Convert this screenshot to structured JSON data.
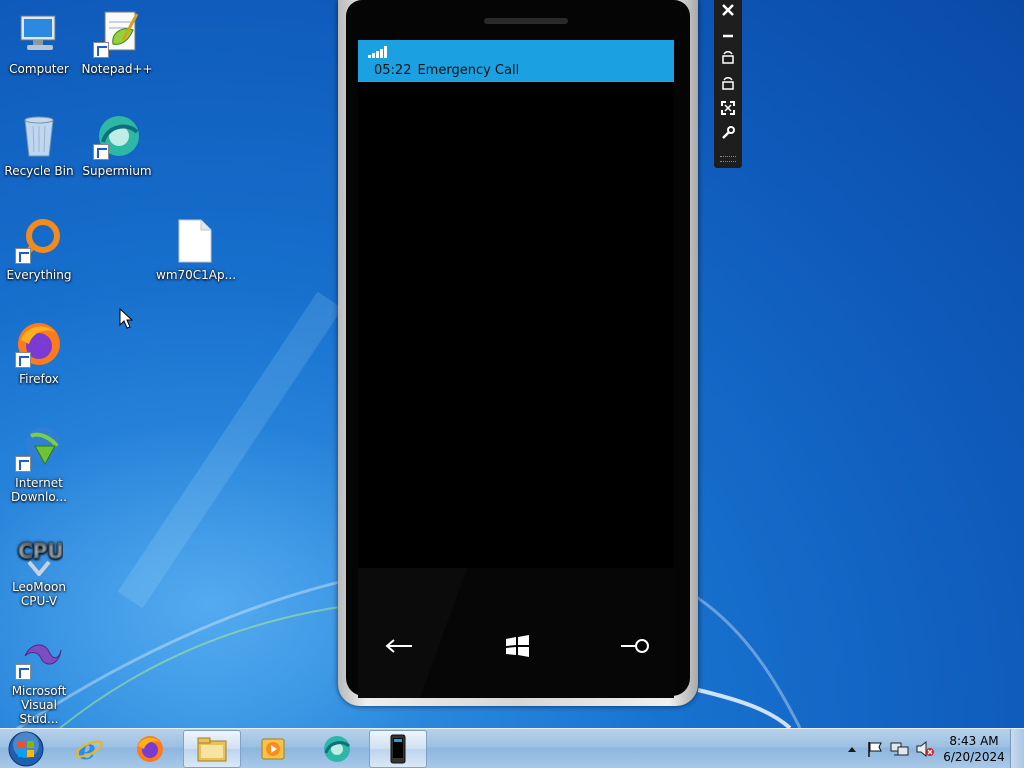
{
  "desktop": {
    "icons": [
      {
        "label": "Computer",
        "icon": "computer-icon"
      },
      {
        "label": "Notepad++",
        "icon": "notepadpp-icon"
      },
      {
        "label": "Recycle Bin",
        "icon": "recycle-bin-icon"
      },
      {
        "label": "Supermium",
        "icon": "supermium-icon"
      },
      {
        "label": "Everything",
        "icon": "everything-icon"
      },
      {
        "label": "wm70C1Ap...",
        "icon": "file-icon"
      },
      {
        "label": "Firefox",
        "icon": "firefox-icon"
      },
      {
        "label": "Internet Downlo...",
        "icon": "internet-download-manager-icon"
      },
      {
        "label": "LeoMoon CPU-V",
        "icon": "cpu-v-icon"
      },
      {
        "label": "Microsoft Visual Stud...",
        "icon": "visual-studio-icon"
      }
    ]
  },
  "emulator": {
    "status_time": "05:22",
    "status_text": "Emergency Call",
    "accent_color": "#1ba1e2",
    "toolbar": [
      "close-icon",
      "minimize-icon",
      "rotate-left-icon",
      "rotate-right-icon",
      "fit-to-screen-icon",
      "tools-icon"
    ]
  },
  "taskbar": {
    "pinned": [
      "start-orb-icon",
      "internet-explorer-icon",
      "firefox-icon",
      "file-explorer-icon",
      "media-player-icon",
      "supermium-icon",
      "phone-emulator-icon"
    ],
    "clock_time": "8:43 AM",
    "clock_date": "6/20/2024",
    "tray_icons": [
      "show-hidden-icons-icon",
      "action-center-flag-icon",
      "network-icon",
      "volume-muted-icon"
    ]
  }
}
